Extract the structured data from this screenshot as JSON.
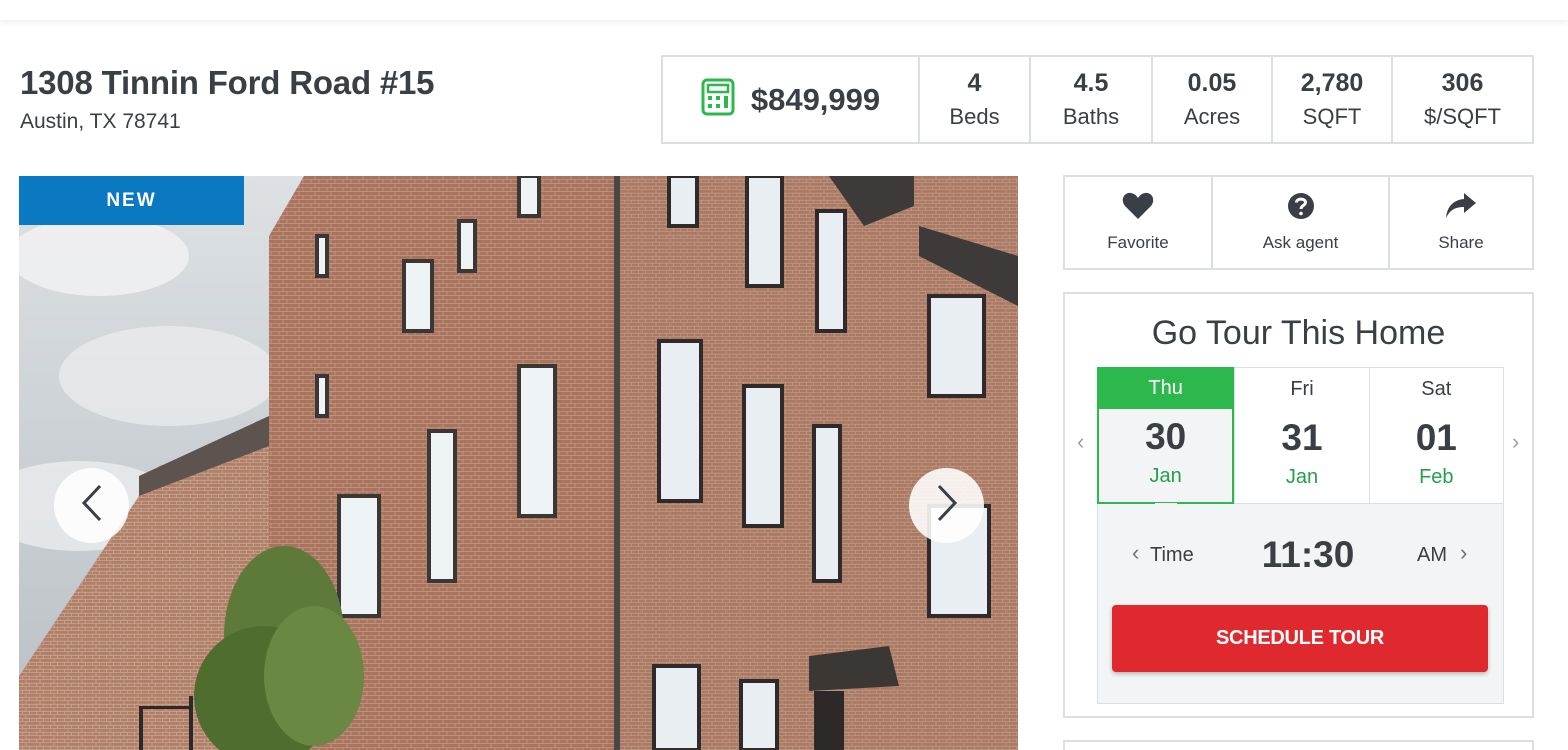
{
  "listing": {
    "street": "1308 Tinnin Ford Road #15",
    "city_line": "Austin, TX 78741",
    "price": "$849,999",
    "price_icon": "calculator-icon",
    "stats": [
      {
        "value": "4",
        "label": "Beds"
      },
      {
        "value": "4.5",
        "label": "Baths"
      },
      {
        "value": "0.05",
        "label": "Acres"
      },
      {
        "value": "2,780",
        "label": "SQFT"
      },
      {
        "value": "306",
        "label": "$/SQFT"
      }
    ]
  },
  "gallery": {
    "badge": "NEW",
    "prev_icon": "chevron-left-icon",
    "next_icon": "chevron-right-icon"
  },
  "actions": [
    {
      "label": "Favorite",
      "icon": "heart-icon"
    },
    {
      "label": "Ask agent",
      "icon": "question-circle-icon"
    },
    {
      "label": "Share",
      "icon": "share-arrow-icon"
    }
  ],
  "tour": {
    "title": "Go Tour This Home",
    "days": [
      {
        "name": "Thu",
        "num": "30",
        "month": "Jan",
        "selected": true
      },
      {
        "name": "Fri",
        "num": "31",
        "month": "Jan",
        "selected": false
      },
      {
        "name": "Sat",
        "num": "01",
        "month": "Feb",
        "selected": false
      }
    ],
    "time_label": "Time",
    "time_value": "11:30",
    "ampm": "AM",
    "schedule_label": "SCHEDULE TOUR"
  },
  "colors": {
    "accent_green": "#2db84d",
    "badge_blue": "#0b78c2",
    "cta_red": "#e0292f",
    "text": "#3a3f45"
  }
}
